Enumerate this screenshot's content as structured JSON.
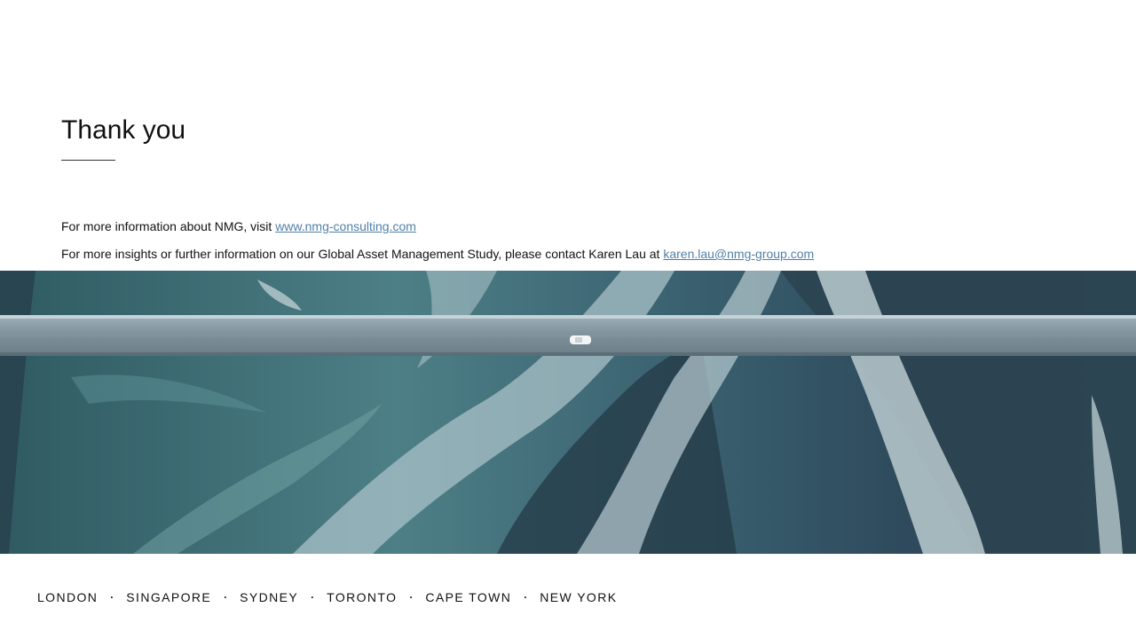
{
  "slide": {
    "title": "Thank you",
    "info": {
      "line1_prefix": "For more information about NMG, visit ",
      "line1_link": "www.nmg-consulting.com",
      "line2_prefix": "For more insights or further information on our Global Asset Management Study, please contact Karen Lau at ",
      "line2_link": "karen.lau@nmg-group.com"
    },
    "banner": {
      "image_subject": "aerial view of a bridge crossing braided glacial river"
    },
    "footer": {
      "separator": "·",
      "cities": [
        "LONDON",
        "SINGAPORE",
        "SYDNEY",
        "TORONTO",
        "CAPE TOWN",
        "NEW YORK"
      ]
    }
  },
  "colors": {
    "link": "#4f7fa8",
    "text": "#111111",
    "water_teal": "#3f6f78",
    "sediment_light": "#b9ccd2",
    "bridge_gray": "#7d8f99"
  }
}
